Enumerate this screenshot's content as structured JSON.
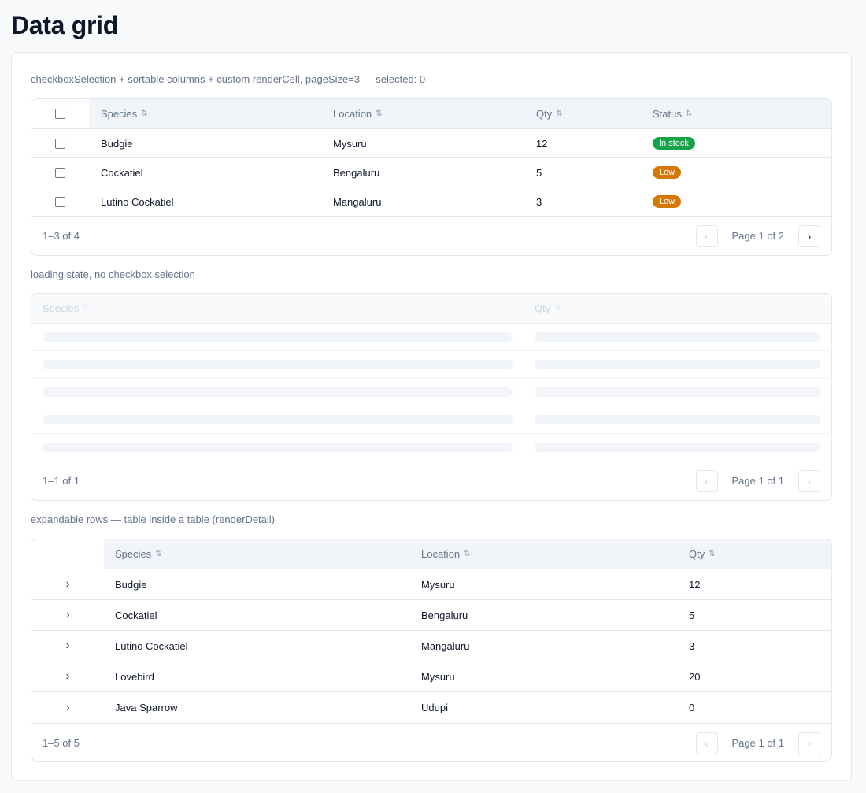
{
  "page": {
    "title": "Data grid"
  },
  "colors": {
    "in_stock": "#16a34a",
    "low": "#d97706"
  },
  "grid1": {
    "caption": "checkboxSelection + sortable columns + custom renderCell, pageSize=3 — selected: 0",
    "columns": [
      "Species",
      "Location",
      "Qty",
      "Status"
    ],
    "rows": [
      {
        "species": "Budgie",
        "location": "Mysuru",
        "qty": "12",
        "status": "In stock"
      },
      {
        "species": "Cockatiel",
        "location": "Bengaluru",
        "qty": "5",
        "status": "Low"
      },
      {
        "species": "Lutino Cockatiel",
        "location": "Mangaluru",
        "qty": "3",
        "status": "Low"
      }
    ],
    "count": "1–3 of 4",
    "page_info": "Page 1 of 2"
  },
  "grid2": {
    "caption": "loading state, no checkbox selection",
    "columns": [
      "Species",
      "Qty"
    ],
    "count": "1–1 of 1",
    "page_info": "Page 1 of 1"
  },
  "grid3": {
    "caption": "expandable rows — table inside a table (renderDetail)",
    "columns": [
      "Species",
      "Location",
      "Qty"
    ],
    "rows": [
      {
        "species": "Budgie",
        "location": "Mysuru",
        "qty": "12"
      },
      {
        "species": "Cockatiel",
        "location": "Bengaluru",
        "qty": "5"
      },
      {
        "species": "Lutino Cockatiel",
        "location": "Mangaluru",
        "qty": "3"
      },
      {
        "species": "Lovebird",
        "location": "Mysuru",
        "qty": "20"
      },
      {
        "species": "Java Sparrow",
        "location": "Udupi",
        "qty": "0"
      }
    ],
    "count": "1–5 of 5",
    "page_info": "Page 1 of 1"
  },
  "icons": {
    "sort": "⇅",
    "prev": "‹",
    "next": "›",
    "expand": "›"
  }
}
